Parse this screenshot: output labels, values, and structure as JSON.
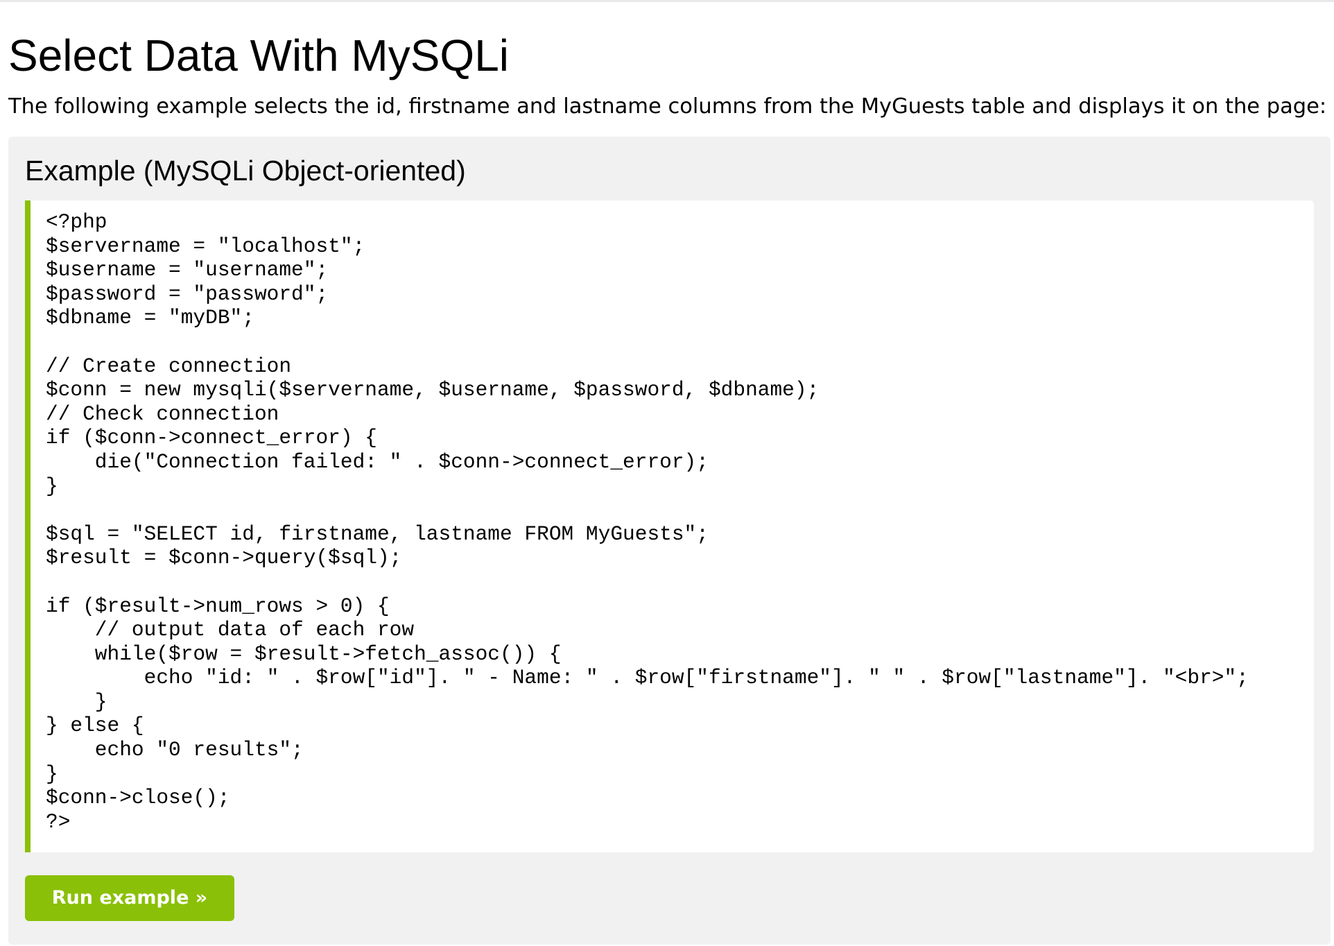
{
  "page": {
    "title": "Select Data With MySQLi",
    "intro": "The following example selects the id, firstname and lastname columns from the MyGuests table and displays it on the page:"
  },
  "example": {
    "heading": "Example (MySQLi Object-oriented)",
    "code": "<?php\n$servername = \"localhost\";\n$username = \"username\";\n$password = \"password\";\n$dbname = \"myDB\";\n\n// Create connection\n$conn = new mysqli($servername, $username, $password, $dbname);\n// Check connection\nif ($conn->connect_error) {\n    die(\"Connection failed: \" . $conn->connect_error);\n}\n\n$sql = \"SELECT id, firstname, lastname FROM MyGuests\";\n$result = $conn->query($sql);\n\nif ($result->num_rows > 0) {\n    // output data of each row\n    while($row = $result->fetch_assoc()) {\n        echo \"id: \" . $row[\"id\"]. \" - Name: \" . $row[\"firstname\"]. \" \" . $row[\"lastname\"]. \"<br>\";\n    }\n} else {\n    echo \"0 results\";\n}\n$conn->close();\n?>",
    "run_button_label": "Run example »"
  },
  "colors": {
    "accent": "#8ac007",
    "example_background": "#f1f1f1",
    "code_background": "#ffffff"
  }
}
